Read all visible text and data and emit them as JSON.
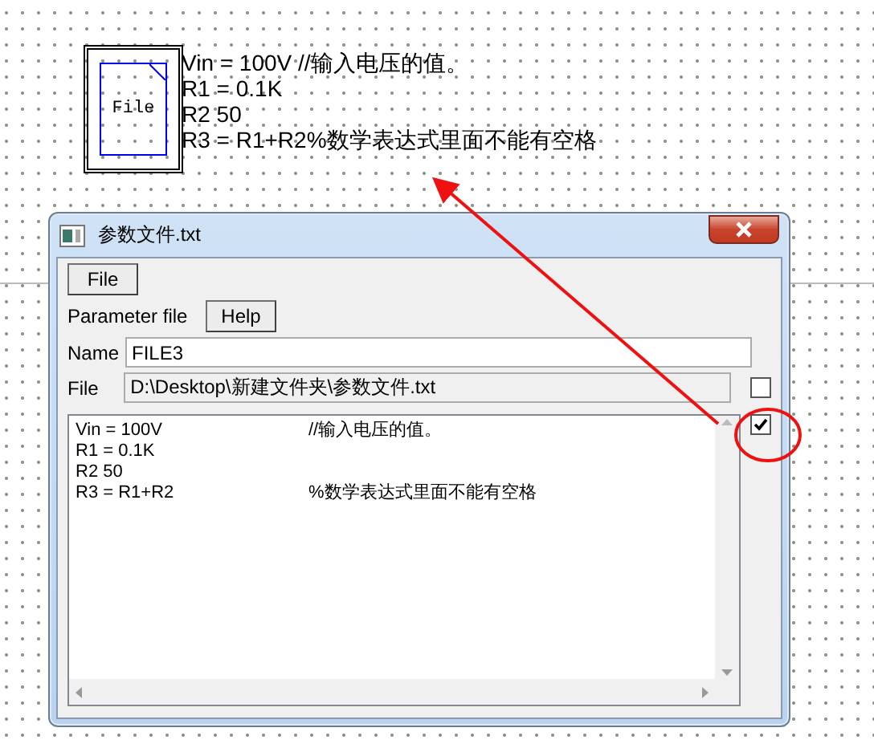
{
  "canvas": {
    "file_block": {
      "label": "File"
    },
    "text_lines": [
      "Vin = 100V //输入电压的值。",
      "R1 = 0.1K",
      "R2 50",
      "R3 = R1+R2%数学表达式里面不能有空格"
    ]
  },
  "window": {
    "title": "参数文件.txt",
    "file_button": "File",
    "parameter_label": "Parameter file",
    "help_button": "Help",
    "name": {
      "label": "Name",
      "value": "FILE3"
    },
    "file": {
      "label": "File",
      "value": "D:\\Desktop\\新建文件夹\\参数文件.txt",
      "disabled": true,
      "checked": false
    },
    "editor": {
      "checked": true,
      "lines": [
        {
          "code": "Vin = 100V",
          "comment": "//输入电压的值。"
        },
        {
          "code": "R1 = 0.1K"
        },
        {
          "code": "R2 50"
        },
        {
          "code": "R3 = R1+R2",
          "comment": "%数学表达式里面不能有空格"
        }
      ]
    }
  }
}
